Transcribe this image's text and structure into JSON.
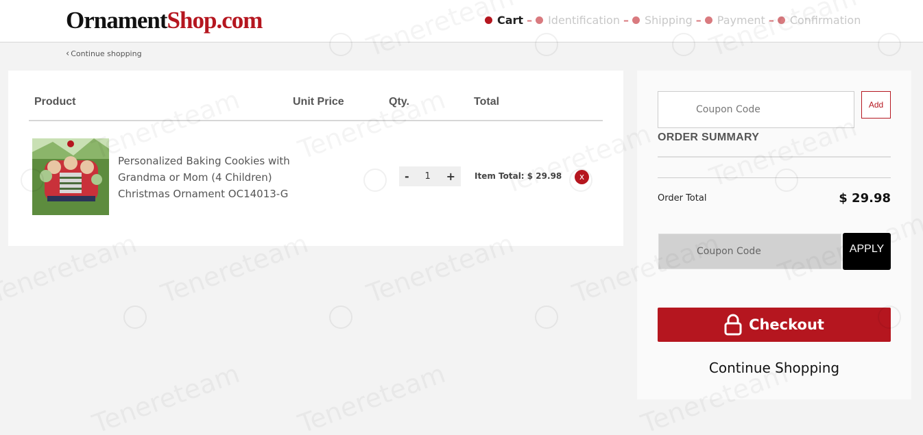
{
  "header": {
    "logo_part1": "Ornament",
    "logo_part2": "Shop.com",
    "steps": [
      {
        "label": "Cart",
        "active": true
      },
      {
        "label": "Identification",
        "active": false
      },
      {
        "label": "Shipping",
        "active": false
      },
      {
        "label": "Payment",
        "active": false
      },
      {
        "label": "Confirmation",
        "active": false
      }
    ],
    "step_separator": "–"
  },
  "nav": {
    "continue_link": "Continue shopping"
  },
  "cart": {
    "columns": {
      "product": "Product",
      "unit_price": "Unit Price",
      "qty": "Qty.",
      "total": "Total"
    },
    "items": [
      {
        "name": "Personalized Baking Cookies with Grandma or Mom (4 Children) Christmas Ornament OC14013-G",
        "quantity": "1",
        "qty_minus": "-",
        "qty_plus": "+",
        "item_total_text": "Item Total: $ 29.98",
        "remove_label": "x"
      }
    ]
  },
  "summary": {
    "coupon_placeholder": "Coupon Code",
    "add_label": "Add",
    "title": "ORDER SUMMARY",
    "order_total_label": "Order Total",
    "order_total_value": "$ 29.98",
    "coupon2_placeholder": "Coupon Code",
    "apply_label": "APPLY",
    "checkout_label": "Checkout",
    "continue_shopping_label": "Continue Shopping"
  },
  "watermark_text": "Tenereteam",
  "colors": {
    "brand_red": "#b5161f",
    "step_dot_inactive": "#d97a7f",
    "page_bg": "#f3f3f3"
  }
}
